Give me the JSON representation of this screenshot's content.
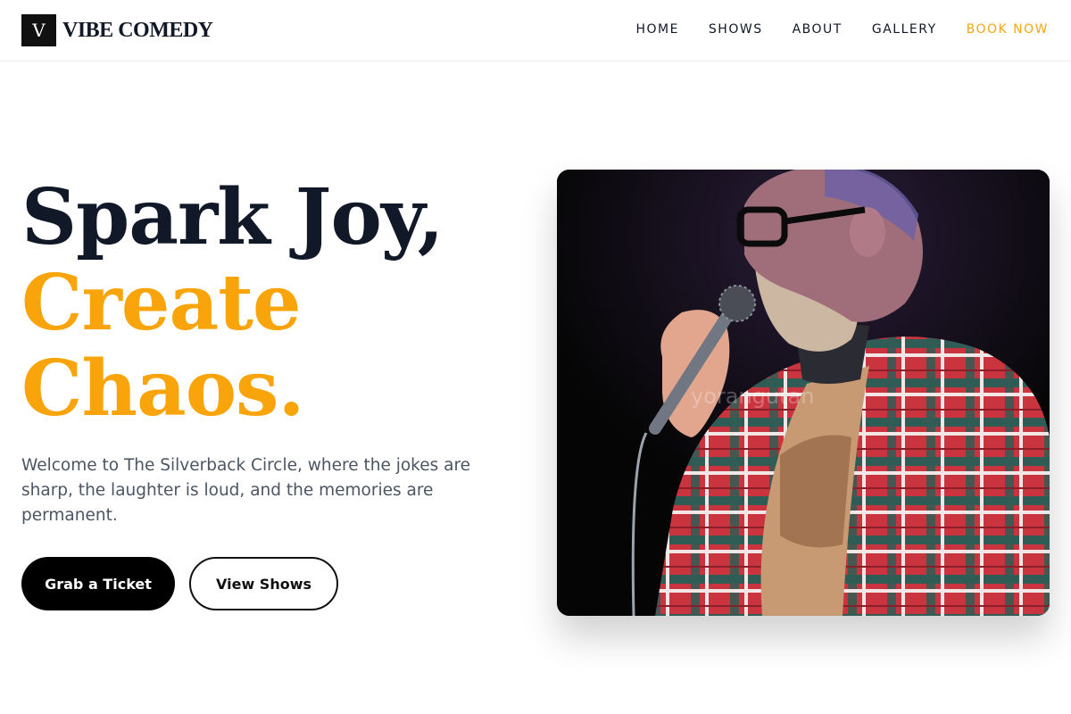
{
  "brand": {
    "logo_mark": "V",
    "name": "VIBE COMEDY"
  },
  "nav": {
    "items": [
      {
        "label": "HOME"
      },
      {
        "label": "SHOWS"
      },
      {
        "label": "ABOUT"
      },
      {
        "label": "GALLERY"
      },
      {
        "label": "BOOK NOW"
      }
    ]
  },
  "hero": {
    "headline_line1": "Spark Joy,",
    "headline_line2": "Create",
    "headline_line3": "Chaos.",
    "lead": "Welcome to The Silverback Circle, where the jokes are sharp, the laughter is loud, and the memories are permanent.",
    "primary_button": "Grab a Ticket",
    "secondary_button": "View Shows",
    "photo_watermark": "yorangutan",
    "icon": "comedian-with-microphone-photo"
  },
  "colors": {
    "accent": "#f9a40a",
    "nav_cta": "#f2a716",
    "dark": "#111827",
    "body_text": "#4b5563"
  }
}
